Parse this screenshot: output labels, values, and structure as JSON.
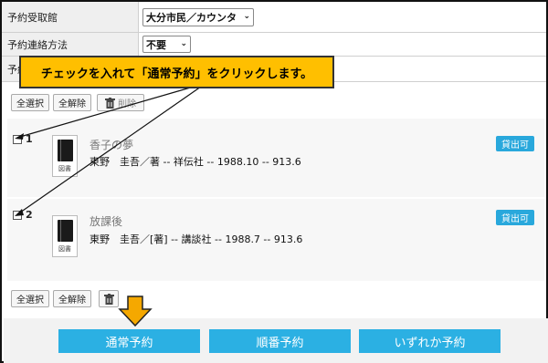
{
  "form": {
    "rows": [
      {
        "label": "予約受取館",
        "value": "大分市民／カウンタ"
      },
      {
        "label": "予約連絡方法",
        "value": "不要"
      },
      {
        "label": "予約"
      }
    ]
  },
  "callout": {
    "text": "チェックを入れて「通常予約」をクリックします。"
  },
  "toolbar": {
    "select_all": "全選択",
    "deselect_all": "全解除",
    "delete": "削除"
  },
  "items": [
    {
      "number": "1",
      "title": "香子の夢",
      "meta": "東野　圭吾／著 -- 祥伝社 -- 1988.10 -- 913.6",
      "type": "図書",
      "status": "貸出可"
    },
    {
      "number": "2",
      "title": "放課後",
      "meta": "東野　圭吾／[著] -- 講談社 -- 1988.7 -- 913.6",
      "type": "図書",
      "status": "貸出可"
    }
  ],
  "actions": {
    "normal": "通常予約",
    "sequential": "順番予約",
    "either": "いずれか予約"
  },
  "colors": {
    "accent": "#2bb0e3",
    "callout": "#ffbf00",
    "arrow": "#f5a800"
  },
  "icons": [
    "chevron-down-icon",
    "trash-icon",
    "book-icon",
    "down-arrow-icon"
  ]
}
